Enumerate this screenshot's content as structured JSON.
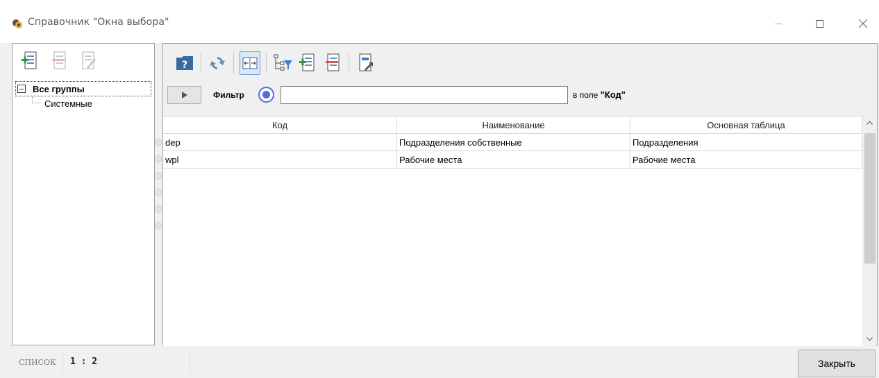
{
  "window": {
    "title": "Справочник \"Окна выбора\"",
    "icon": "directory-app-icon"
  },
  "left_panel": {
    "toolbar": [
      {
        "name": "add-group-icon"
      },
      {
        "name": "delete-group-icon"
      },
      {
        "name": "edit-group-icon"
      }
    ],
    "tree": {
      "root_label": "Все группы",
      "children": [
        "Системные"
      ]
    }
  },
  "toolbar": {
    "buttons": [
      "help-icon",
      "refresh-icon",
      "fit-columns-icon",
      "tree-filter-icon",
      "add-record-icon",
      "delete-record-icon",
      "export-icon"
    ]
  },
  "filter": {
    "label": "Фильтр",
    "value": "",
    "field_prefix": "в поле ",
    "field_name": "\"Код\""
  },
  "grid": {
    "columns": [
      "Код",
      "Наименование",
      "Основная таблица"
    ],
    "rows": [
      [
        "dep",
        "Подразделения собственные",
        "Подразделения"
      ],
      [
        "wpl",
        "Рабочие места",
        "Рабочие места"
      ]
    ]
  },
  "status": {
    "mode": "СПИСОК",
    "count": "1 : 2",
    "close_button": "Закрыть"
  },
  "colors": {
    "accent": "#4a6ee0",
    "border": "#a0a0a0",
    "add_icon": "#2e9b3e",
    "delete_icon": "#d9534f",
    "folder_icon": "#3a6aa0"
  }
}
